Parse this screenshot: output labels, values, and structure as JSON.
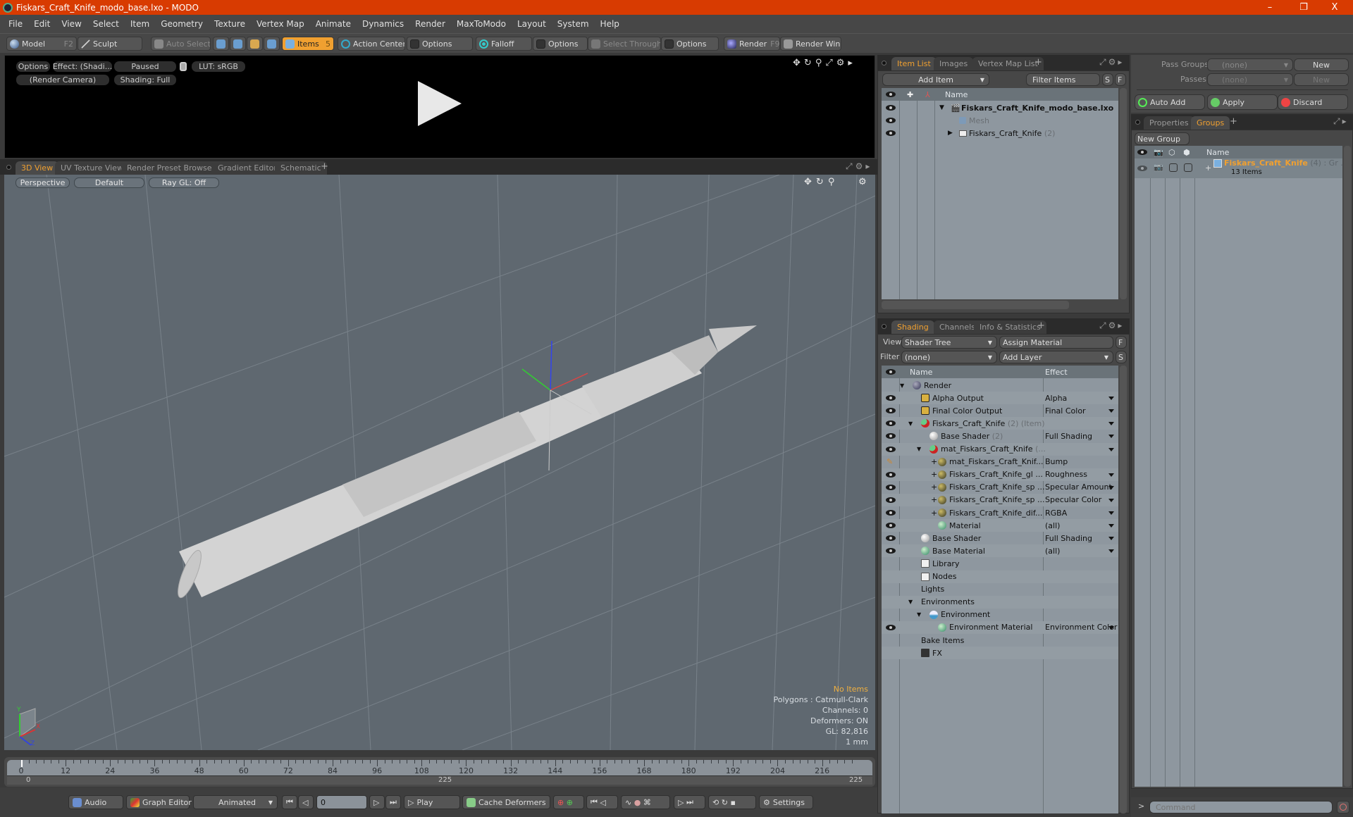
{
  "window": {
    "title": "Fiskars_Craft_Knife_modo_base.lxo - MODO",
    "controls": [
      "–",
      "❐",
      "X"
    ]
  },
  "menu": [
    "File",
    "Edit",
    "View",
    "Select",
    "Item",
    "Geometry",
    "Texture",
    "Vertex Map",
    "Animate",
    "Dynamics",
    "Render",
    "MaxToModo",
    "Layout",
    "System",
    "Help"
  ],
  "toolbar": {
    "model": "Model",
    "model_key": "F2",
    "sculpt": "Sculpt",
    "auto_select": "Auto Select",
    "items": "Items",
    "items_count": "5",
    "action_center": "Action Center",
    "options1": "Options",
    "falloff": "Falloff",
    "options2": "Options",
    "select_through": "Select Through",
    "options3": "Options",
    "render": "Render",
    "render_key": "F9",
    "render_window": "Render Window"
  },
  "render_preview": {
    "options": "Options",
    "effect": "Effect: (Shadi...",
    "status": "Paused",
    "lut": "LUT: sRGB",
    "camera": "(Render Camera)",
    "shading": "Shading: Full"
  },
  "viewport_tabs": [
    "3D View",
    "UV Texture View",
    "Render Preset Browser",
    "Gradient Editor",
    "Schematic"
  ],
  "viewport": {
    "projection": "Perspective",
    "style": "Default",
    "raygl": "Ray GL: Off",
    "stats": {
      "selection": "No Items",
      "polygons": "Polygons : Catmull-Clark",
      "channels": "Channels: 0",
      "deformers": "Deformers: ON",
      "gl": "GL: 82,816",
      "unit": "1 mm"
    },
    "axis_labels": {
      "x": "X",
      "y": "Y",
      "z": "Z"
    }
  },
  "timeline": {
    "ticks": [
      0,
      12,
      24,
      36,
      48,
      60,
      72,
      84,
      96,
      108,
      120,
      132,
      144,
      156,
      168,
      180,
      192,
      204,
      216
    ],
    "start": "0",
    "end": "225",
    "mid": "225",
    "current": 0,
    "max": 225
  },
  "transport": {
    "audio": "Audio",
    "graph_editor": "Graph Editor",
    "mode": "Animated",
    "frame": "0",
    "play": "Play",
    "cache": "Cache Deformers",
    "settings": "Settings"
  },
  "item_list": {
    "tabs": [
      "Item List",
      "Images",
      "Vertex Map List"
    ],
    "add_item": "Add Item",
    "filter": "Filter Items",
    "s": "S",
    "f": "F",
    "col_name": "Name",
    "rows": [
      {
        "name": "Fiskars_Craft_Knife_modo_base.lxo",
        "bold": true,
        "indent": 0,
        "arrow": "▼"
      },
      {
        "name": "Mesh",
        "dim": true,
        "indent": 1
      },
      {
        "name": "Fiskars_Craft_Knife",
        "count": "(2)",
        "indent": 1,
        "arrow": "▶"
      }
    ]
  },
  "shading": {
    "tabs": [
      "Shading",
      "Channels",
      "Info & Statistics"
    ],
    "view_label": "View",
    "view_value": "Shader Tree",
    "assign": "Assign Material",
    "f": "F",
    "filter_label": "Filter",
    "filter_value": "(none)",
    "add_layer": "Add Layer",
    "s": "S",
    "col_name": "Name",
    "col_effect": "Effect",
    "rows": [
      {
        "name": "Render",
        "effect": "",
        "indent": 0,
        "icon": "render",
        "eye": false,
        "arrow": "▼"
      },
      {
        "name": "Alpha Output",
        "effect": "Alpha",
        "indent": 1,
        "icon": "output",
        "eye": true
      },
      {
        "name": "Final Color Output",
        "effect": "Final Color",
        "indent": 1,
        "icon": "output",
        "eye": true
      },
      {
        "name": "Fiskars_Craft_Knife",
        "extra": "(2) (Item)",
        "effect": "",
        "indent": 1,
        "icon": "mask",
        "eye": true,
        "arrow": "▼"
      },
      {
        "name": "Base Shader",
        "extra": "(2)",
        "effect": "Full Shading",
        "indent": 2,
        "icon": "shader",
        "eye": true
      },
      {
        "name": "mat_Fiskars_Craft_Knife",
        "extra": "(...",
        "effect": "",
        "indent": 2,
        "icon": "mask",
        "eye": true,
        "arrow": "▼"
      },
      {
        "name": "mat_Fiskars_Craft_Knif...",
        "effect": "Bump",
        "indent": 3,
        "icon": "image",
        "eye": false,
        "brush": true,
        "plus": true
      },
      {
        "name": "Fiskars_Craft_Knife_gl ...",
        "effect": "Roughness",
        "indent": 3,
        "icon": "image",
        "eye": true,
        "plus": true
      },
      {
        "name": "Fiskars_Craft_Knife_sp ...",
        "effect": "Specular Amount",
        "indent": 3,
        "icon": "image",
        "eye": true,
        "plus": true
      },
      {
        "name": "Fiskars_Craft_Knife_sp ...",
        "effect": "Specular Color",
        "indent": 3,
        "icon": "image",
        "eye": true,
        "plus": true
      },
      {
        "name": "Fiskars_Craft_Knife_dif...",
        "effect": "RGBA",
        "indent": 3,
        "icon": "image",
        "eye": true,
        "plus": true
      },
      {
        "name": "Material",
        "effect": "(all)",
        "indent": 3,
        "icon": "material",
        "eye": true
      },
      {
        "name": "Base Shader",
        "effect": "Full Shading",
        "indent": 1,
        "icon": "shader",
        "eye": true
      },
      {
        "name": "Base Material",
        "effect": "(all)",
        "indent": 1,
        "icon": "material",
        "eye": true
      },
      {
        "name": "Library",
        "effect": "",
        "indent": 1,
        "icon": "folder",
        "eye": false
      },
      {
        "name": "Nodes",
        "effect": "",
        "indent": 1,
        "icon": "folder",
        "eye": false
      },
      {
        "name": "Lights",
        "effect": "",
        "indent": 1,
        "icon": "none",
        "eye": false
      },
      {
        "name": "Environments",
        "effect": "",
        "indent": 1,
        "icon": "none",
        "eye": false,
        "arrow": "▼",
        "arrow_outer": true
      },
      {
        "name": "Environment",
        "effect": "",
        "indent": 2,
        "icon": "env",
        "eye": false,
        "arrow": "▼"
      },
      {
        "name": "Environment Material",
        "effect": "Environment Color",
        "indent": 3,
        "icon": "material",
        "eye": true
      },
      {
        "name": "Bake Items",
        "effect": "",
        "indent": 1,
        "icon": "none",
        "eye": false
      },
      {
        "name": "FX",
        "effect": "",
        "indent": 1,
        "icon": "clapper",
        "eye": false
      }
    ]
  },
  "groups_panel": {
    "pass_groups_label": "Pass Groups",
    "pass_groups_value": "(none)",
    "new1": "New",
    "passes_label": "Passes",
    "passes_value": "(none)",
    "new2": "New",
    "auto_add": "Auto Add",
    "apply": "Apply",
    "discard": "Discard",
    "tabs": [
      "Properties",
      "Groups"
    ],
    "new_group": "New Group",
    "col_name": "Name",
    "group": {
      "name": "Fiskars_Craft_Knife",
      "count": "(4)",
      "type": ": Gr ...",
      "items": "13 Items"
    }
  },
  "command": {
    "placeholder": "Command",
    "prompt": ">"
  },
  "colors": {
    "accent": "#f0a030",
    "titlebar": "#d83b01",
    "viewport_bg": "#5f6870"
  }
}
